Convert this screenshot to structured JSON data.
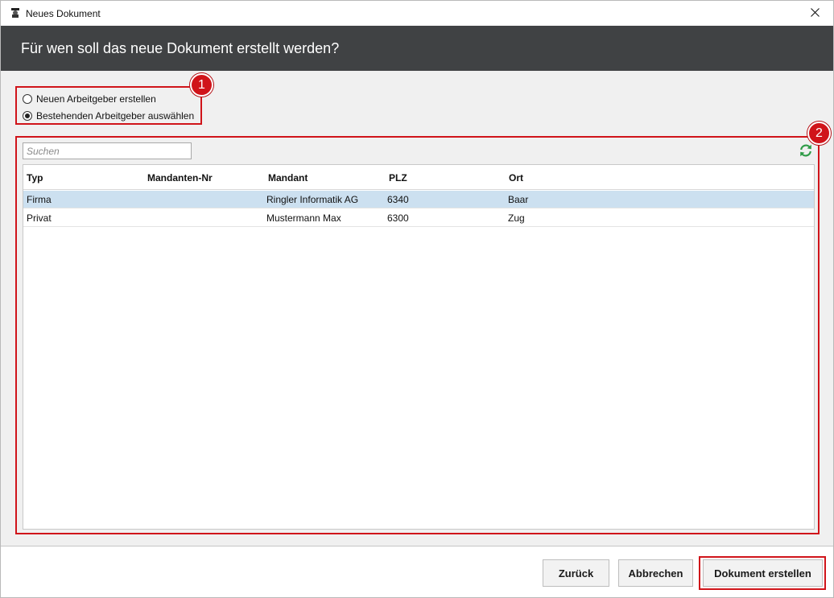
{
  "window": {
    "title": "Neues Dokument"
  },
  "header": {
    "question": "Für wen soll das neue Dokument erstellt werden?"
  },
  "options": {
    "items": [
      {
        "label": "Neuen Arbeitgeber erstellen",
        "selected": false
      },
      {
        "label": "Bestehenden Arbeitgeber auswählen",
        "selected": true
      }
    ]
  },
  "badges": {
    "one": "1",
    "two": "2"
  },
  "search": {
    "placeholder": "Suchen",
    "value": ""
  },
  "table": {
    "columns": [
      "Typ",
      "Mandanten-Nr",
      "Mandant",
      "PLZ",
      "Ort"
    ],
    "rows": [
      {
        "typ": "Firma",
        "mandanten_nr": "",
        "mandant": "Ringler Informatik AG",
        "plz": "6340",
        "ort": "Baar",
        "selected": true
      },
      {
        "typ": "Privat",
        "mandanten_nr": "",
        "mandant": "Mustermann Max",
        "plz": "6300",
        "ort": "Zug",
        "selected": false
      }
    ]
  },
  "footer": {
    "back_label": "Zurück",
    "cancel_label": "Abbrechen",
    "create_label": "Dokument erstellen"
  },
  "colors": {
    "header_bg": "#404244",
    "highlight_red": "#d0141a",
    "selected_row": "#cce0f0",
    "refresh_green": "#2e9b46"
  },
  "icons": {
    "app": "app-logo-icon",
    "close": "close-icon",
    "refresh": "refresh-icon"
  }
}
